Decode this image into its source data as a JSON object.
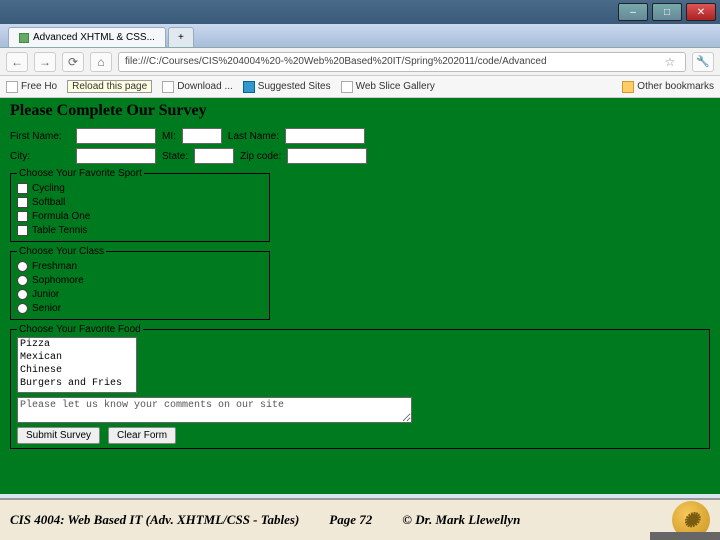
{
  "window": {
    "min": "–",
    "max": "□",
    "close": "✕"
  },
  "tab": {
    "title": "Advanced XHTML & CSS...",
    "new": "+"
  },
  "nav": {
    "back": "←",
    "fwd": "→",
    "reload": "⟳",
    "home": "⌂",
    "url": "file:///C:/Courses/CIS%204004%20-%20Web%20Based%20IT/Spring%202011/code/Advanced",
    "star": "☆",
    "wrench": "🔧"
  },
  "tooltip": "Reload this page",
  "bookmarks": {
    "a": "Free Ho",
    "b": "Download ...",
    "c": "Suggested Sites",
    "d": "Web Slice Gallery",
    "other": "Other bookmarks"
  },
  "survey": {
    "title": "Please Complete Our Survey",
    "row1": {
      "first": "First Name:",
      "mi": "MI:",
      "last": "Last Name:"
    },
    "row2": {
      "city": "City:",
      "state": "State:",
      "zip": "Zip code:"
    },
    "sport": {
      "legend": "Choose Your Favorite Sport",
      "o1": "Cycling",
      "o2": "Softball",
      "o3": "Formula One",
      "o4": "Table Tennis"
    },
    "class": {
      "legend": "Choose Your Class",
      "o1": "Freshman",
      "o2": "Sophomore",
      "o3": "Junior",
      "o4": "Senior"
    },
    "food": {
      "legend": "Choose Your Favorite Food",
      "o1": "Pizza",
      "o2": "Mexican",
      "o3": "Chinese",
      "o4": "Burgers and Fries"
    },
    "textarea_ph": "Please let us know your comments on our site",
    "submit": "Submit Survey",
    "clear": "Clear Form"
  },
  "footer": {
    "course": "CIS 4004: Web Based IT (Adv. XHTML/CSS - Tables)",
    "page": "Page 72",
    "copy": "© Dr. Mark Llewellyn"
  }
}
